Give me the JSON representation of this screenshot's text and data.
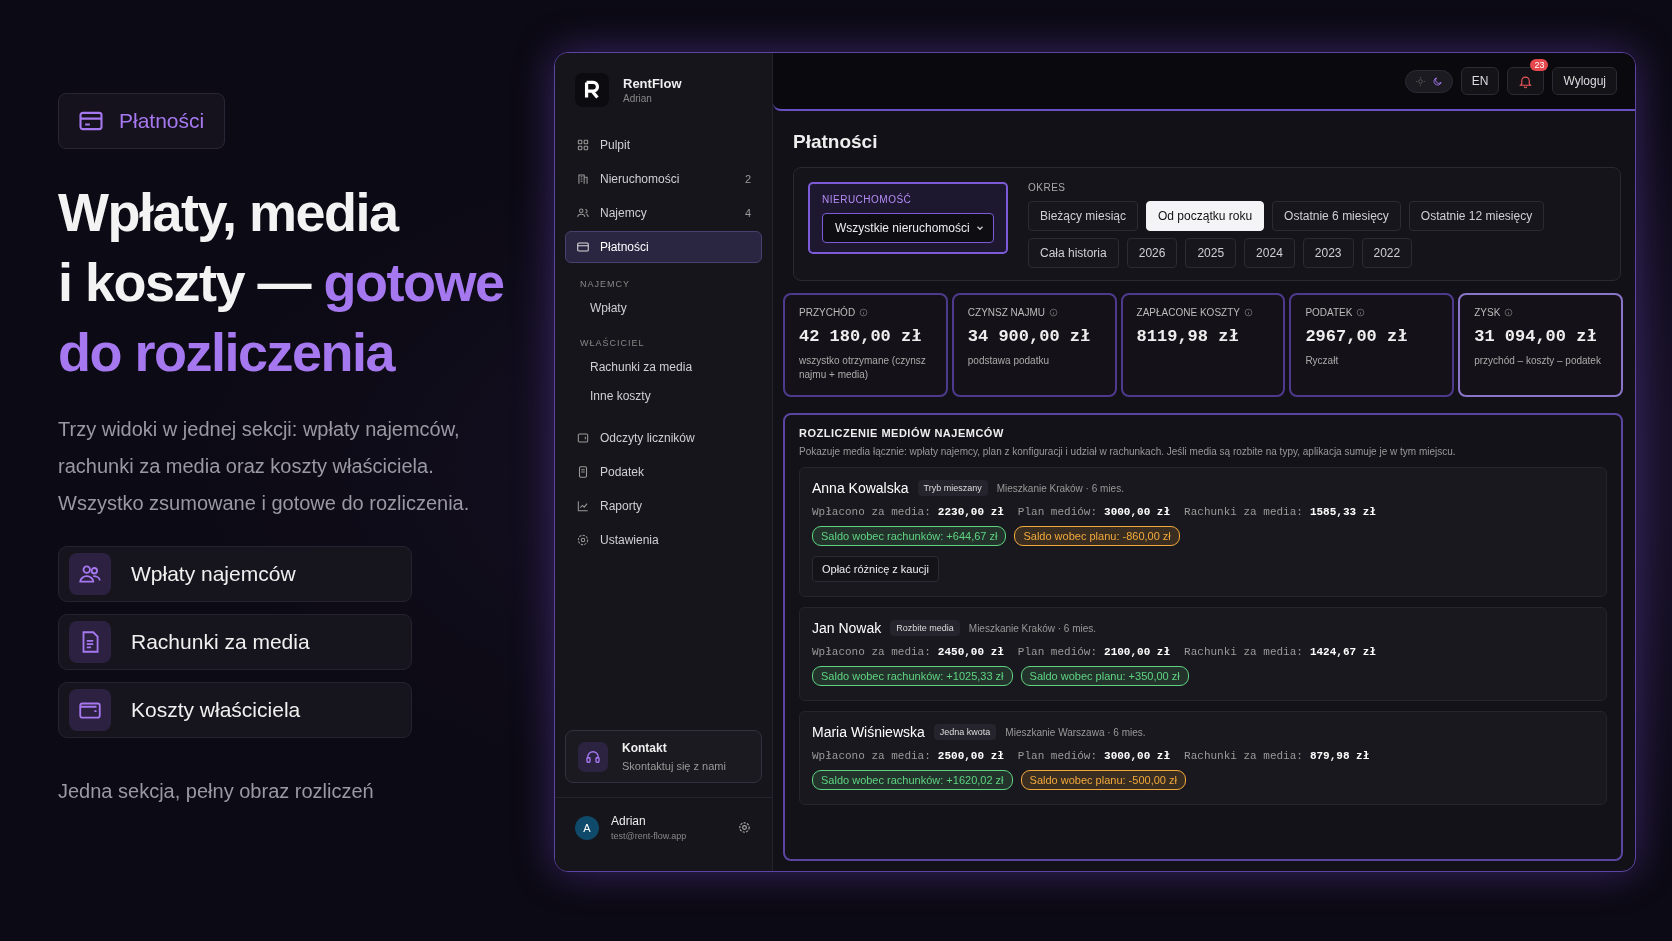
{
  "promo": {
    "chip": "Płatności",
    "headline": [
      {
        "text": "Wpłaty, media",
        "accent": false
      },
      {
        "text": "i koszty — ",
        "accent": false,
        "inline": true
      },
      {
        "text": "gotowe",
        "accent": true
      },
      {
        "text": "do rozliczenia",
        "accent": true
      }
    ],
    "lead": "Trzy widoki w jednej sekcji: wpłaty najemców, rachunki za media oraz koszty właściciela. Wszystko zsumowane i gotowe do rozliczenia.",
    "features": [
      "Wpłaty najemców",
      "Rachunki za media",
      "Koszty właściciela"
    ],
    "footer": "Jedna sekcja, pełny obraz rozliczeń"
  },
  "app": {
    "brand": {
      "name": "RentFlow",
      "user": "Adrian"
    },
    "sidebar": {
      "items": [
        {
          "kind": "item",
          "label": "Pulpit",
          "selected": false
        },
        {
          "kind": "item",
          "label": "Nieruchomości",
          "count": "2",
          "selected": false
        },
        {
          "kind": "item",
          "label": "Najemcy",
          "count": "4",
          "selected": false
        },
        {
          "kind": "item",
          "label": "Płatności",
          "selected": true
        },
        {
          "kind": "section",
          "label": "NAJEMCY"
        },
        {
          "kind": "sub",
          "label": "Wpłaty",
          "selected": false
        },
        {
          "kind": "section",
          "label": "WŁAŚCICIEL"
        },
        {
          "kind": "sub",
          "label": "Rachunki za media",
          "selected": false
        },
        {
          "kind": "sub",
          "label": "Inne koszty",
          "selected": false
        },
        {
          "kind": "item",
          "label": "Odczyty liczników",
          "selected": false
        },
        {
          "kind": "item",
          "label": "Podatek",
          "selected": false
        },
        {
          "kind": "item",
          "label": "Raporty",
          "selected": false
        },
        {
          "kind": "item",
          "label": "Ustawienia",
          "selected": false
        }
      ],
      "contact": {
        "title": "Kontakt",
        "subtitle": "Skontaktuj się z nami"
      },
      "account": {
        "initial": "A",
        "name": "Adrian",
        "email": "test@rent-flow.app"
      }
    },
    "topbar": {
      "theme_dark": true,
      "language": "EN",
      "notifications": "23",
      "logout": "Wyloguj"
    },
    "title": "Płatności",
    "filters": {
      "property_label": "NIERUCHOMOŚĆ",
      "property_value": "Wszystkie nieruchomości",
      "period_label": "OKRES",
      "periods": [
        {
          "label": "Bieżący miesiąc",
          "selected": false
        },
        {
          "label": "Od początku roku",
          "selected": true
        },
        {
          "label": "Ostatnie 6 miesięcy",
          "selected": false
        },
        {
          "label": "Ostatnie 12 miesięcy",
          "selected": false
        },
        {
          "label": "Cała historia",
          "selected": false
        },
        {
          "label": "2026",
          "selected": false
        },
        {
          "label": "2025",
          "selected": false
        },
        {
          "label": "2024",
          "selected": false
        },
        {
          "label": "2023",
          "selected": false
        },
        {
          "label": "2022",
          "selected": false
        }
      ]
    },
    "stats": [
      {
        "label": "PRZYCHÓD",
        "value": "42 180,00 zł",
        "note": "wszystko otrzymane (czynsz najmu + media)"
      },
      {
        "label": "CZYNSZ NAJMU",
        "value": "34 900,00 zł",
        "note": "podstawa podatku"
      },
      {
        "label": "ZAPŁACONE KOSZTY",
        "value": "8119,98 zł"
      },
      {
        "label": "PODATEK",
        "value": "2967,00 zł",
        "note": "Ryczałt"
      },
      {
        "label": "ZYSK",
        "value": "31 094,00 zł",
        "note": "przychód – koszty – podatek"
      }
    ],
    "media": {
      "title": "ROZLICZENIE MEDIÓW NAJEMCÓW",
      "description": "Pokazuje media łącznie: wpłaty najemcy, plan z konfiguracji i udział w rachunkach. Jeśli media są rozbite na typy, aplikacja sumuje je w tym miejscu.",
      "tenants": [
        {
          "name": "Anna Kowalska",
          "mode": "Tryb mieszany",
          "place": "Mieszkanie Kraków · 6 mies.",
          "fields": [
            {
              "label": "Wpłacono za media:",
              "value": "2230,00 zł"
            },
            {
              "label": "Plan mediów:",
              "value": "3000,00 zł"
            },
            {
              "label": "Rachunki za media:",
              "value": "1585,33 zł"
            }
          ],
          "balances": [
            {
              "text": "Saldo wobec rachunków: +644,67 zł",
              "color": "#5fd382"
            },
            {
              "text": "Saldo wobec planu: -860,00 zł",
              "color": "#f2a93b"
            }
          ],
          "action": "Opłać różnicę z kaucji"
        },
        {
          "name": "Jan Nowak",
          "mode": "Rozbite media",
          "place": "Mieszkanie Kraków · 6 mies.",
          "fields": [
            {
              "label": "Wpłacono za media:",
              "value": "2450,00 zł"
            },
            {
              "label": "Plan mediów:",
              "value": "2100,00 zł"
            },
            {
              "label": "Rachunki za media:",
              "value": "1424,67 zł"
            }
          ],
          "balances": [
            {
              "text": "Saldo wobec rachunków: +1025,33 zł",
              "color": "#5fd382"
            },
            {
              "text": "Saldo wobec planu: +350,00 zł",
              "color": "#5fd382"
            }
          ]
        },
        {
          "name": "Maria Wiśniewska",
          "mode": "Jedna kwota",
          "place": "Mieszkanie Warszawa · 6 mies.",
          "fields": [
            {
              "label": "Wpłacono za media:",
              "value": "2500,00 zł"
            },
            {
              "label": "Plan mediów:",
              "value": "3000,00 zł"
            },
            {
              "label": "Rachunki za media:",
              "value": "879,98 zł"
            }
          ],
          "balances": [
            {
              "text": "Saldo wobec rachunków: +1620,02 zł",
              "color": "#5fd382"
            },
            {
              "text": "Saldo wobec planu: -500,00 zł",
              "color": "#f2a93b"
            }
          ]
        }
      ]
    }
  }
}
